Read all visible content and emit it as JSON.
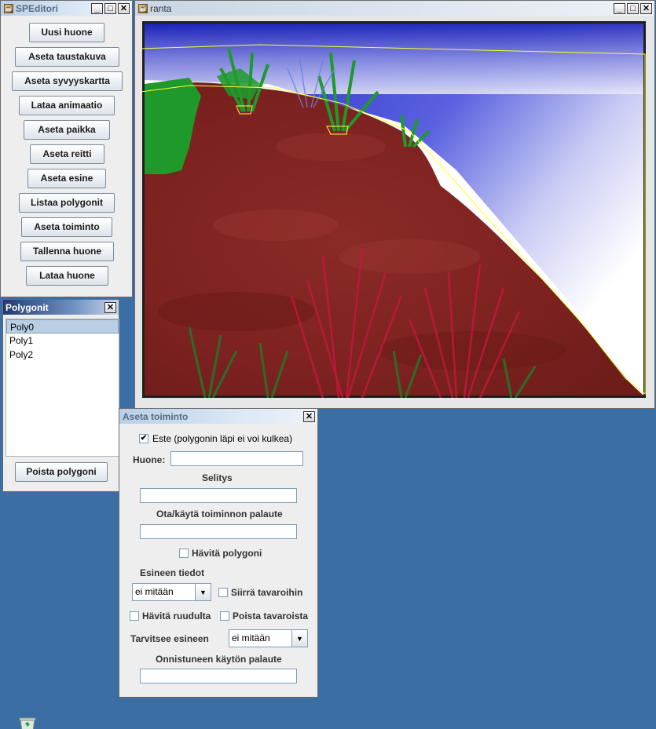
{
  "editor": {
    "title": "SPEditori",
    "buttons": [
      "Uusi huone",
      "Aseta taustakuva",
      "Aseta syvyyskartta",
      "Lataa animaatio",
      "Aseta paikka",
      "Aseta reitti",
      "Aseta esine",
      "Listaa polygonit",
      "Aseta toiminto",
      "Tallenna huone",
      "Lataa huone"
    ]
  },
  "room": {
    "title": "ranta"
  },
  "polygons": {
    "title": "Polygonit",
    "items": [
      "Poly0",
      "Poly1",
      "Poly2"
    ],
    "selected": "Poly0",
    "delete_label": "Poista polygoni"
  },
  "action": {
    "title": "Aseta toiminto",
    "obstacle_label": "Este (polygonin läpi ei voi kulkea)",
    "obstacle_checked": true,
    "room_label": "Huone:",
    "room_value": "",
    "description_label": "Selitys",
    "description_value": "",
    "feedback_label": "Ota/käytä toiminnon palaute",
    "feedback_value": "",
    "hide_polygon_label": "Hävitä polygoni",
    "item_info_label": "Esineen tiedot",
    "item_select_value": "ei mitään",
    "move_to_items_label": "Siirrä tavaroihin",
    "hide_from_screen_label": "Hävitä ruudulta",
    "remove_from_items_label": "Poista tavaroista",
    "needs_item_label": "Tarvitsee esineen",
    "needs_item_value": "ei mitään",
    "success_feedback_label": "Onnistuneen käytön palaute",
    "success_feedback_value": ""
  }
}
